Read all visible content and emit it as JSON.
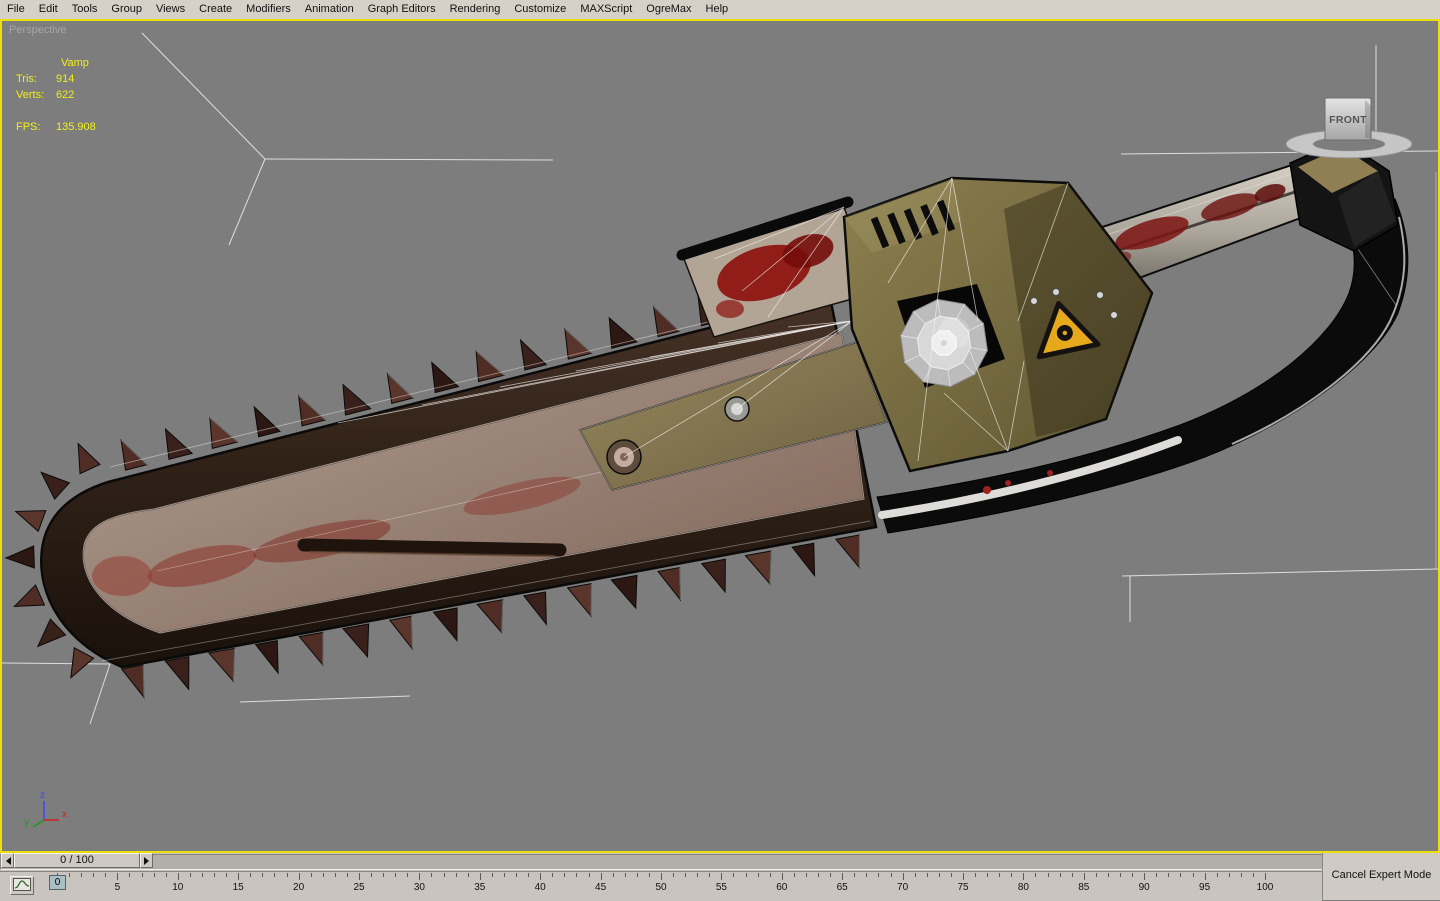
{
  "menu": {
    "items": [
      "File",
      "Edit",
      "Tools",
      "Group",
      "Views",
      "Create",
      "Modifiers",
      "Animation",
      "Graph Editors",
      "Rendering",
      "Customize",
      "MAXScript",
      "OgreMax",
      "Help"
    ]
  },
  "viewport": {
    "label": "Perspective",
    "object_name": "Vamp",
    "stats": {
      "tris_label": "Tris:",
      "tris_value": "914",
      "verts_label": "Verts:",
      "verts_value": "622",
      "fps_label": "FPS:",
      "fps_value": "135.908"
    },
    "gizmo": {
      "label": "FRONT"
    },
    "axis": {
      "x": "x",
      "y": "y",
      "z": "z"
    },
    "colors": {
      "background": "#7d7d7d",
      "active_border": "#e9df0c",
      "stats_text": "#f2ef17",
      "axis_x": "#d02020",
      "axis_y": "#18a018",
      "axis_z": "#4444ff"
    }
  },
  "timeline": {
    "slider_value": "0 / 100",
    "current_frame": "0",
    "frame_min": 0,
    "frame_max": 100,
    "ruler_labels": [
      "0",
      "5",
      "10",
      "15",
      "20",
      "25",
      "30",
      "35",
      "40",
      "45",
      "50",
      "55",
      "60",
      "65",
      "70",
      "75",
      "80",
      "85",
      "90",
      "95",
      "100"
    ]
  },
  "statusbar": {
    "cancel_expert_mode": "Cancel Expert Mode"
  }
}
